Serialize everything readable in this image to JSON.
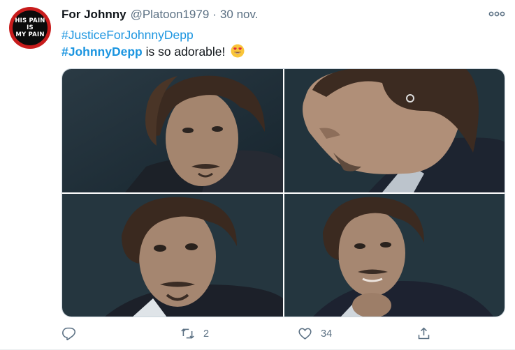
{
  "tweet": {
    "avatar": {
      "lines": [
        "HIS PAIN",
        "IS",
        "MY PAIN"
      ]
    },
    "display_name": "For Johnny",
    "handle": "@Platoon1979",
    "separator": "·",
    "time": "30 nov.",
    "more_icon": "more-horizontal-icon",
    "text": {
      "hashtag_line": "#JusticeForJohnnyDepp",
      "hashtag_bold": "#JohnnyDepp",
      "rest": " is so adorable!",
      "emoji": "heart-eyes-emoji"
    },
    "media": {
      "photos": [
        "photo-1",
        "photo-2",
        "photo-3",
        "photo-4"
      ]
    },
    "actions": {
      "reply": {
        "icon": "reply-icon",
        "count": ""
      },
      "retweet": {
        "icon": "retweet-icon",
        "count": "2"
      },
      "like": {
        "icon": "heart-icon",
        "count": "34"
      },
      "share": {
        "icon": "share-icon"
      }
    },
    "colors": {
      "link": "#1b95e0",
      "secondary": "#5b7083",
      "avatar_ring": "#c81c1c"
    }
  }
}
